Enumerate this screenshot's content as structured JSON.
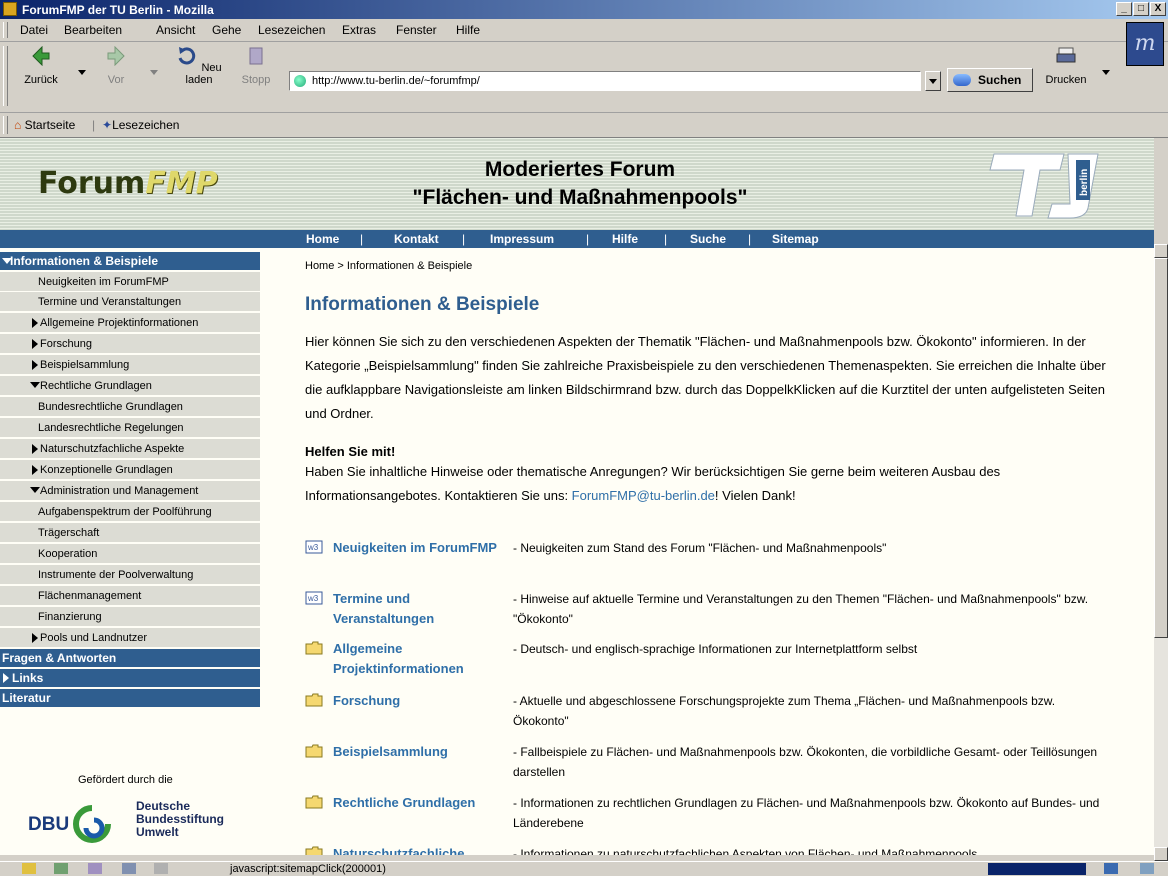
{
  "window": {
    "title": "ForumFMP der TU Berlin - Mozilla",
    "controls": [
      "_",
      "□",
      "X"
    ]
  },
  "menu": [
    "Datei",
    "Bearbeiten",
    "Ansicht",
    "Gehe",
    "Lesezeichen",
    "Extras",
    "Fenster",
    "Hilfe"
  ],
  "toolbar": {
    "back": "Zurück",
    "forward": "Vor",
    "reload": "Neu laden",
    "stop": "Stopp",
    "search": "Suchen",
    "print": "Drucken"
  },
  "url": "http://www.tu-berlin.de/~forumfmp/",
  "bookmarks": {
    "home": "Startseite",
    "bookmarks": "Lesezeichen"
  },
  "banner": {
    "logo_forum": "Forum",
    "logo_fmp": "FMP",
    "title_line1": "Moderiertes Forum",
    "title_line2": "\"Flächen- und Maßnahmenpools\"",
    "tu_text": "berlin"
  },
  "topnav": [
    "Home",
    "Kontakt",
    "Impressum",
    "Hilfe",
    "Suche",
    "Sitemap"
  ],
  "topnav_sep": "|",
  "sidebar": {
    "info": "Informationen & Beispiele",
    "items": [
      "Neuigkeiten im ForumFMP",
      "Termine und Veranstaltungen",
      "Allgemeine Projektinformationen",
      "Forschung",
      "Beispielsammlung",
      "Rechtliche Grundlagen",
      "Bundesrechtliche Grundlagen",
      "Landesrechtliche Regelungen",
      "Naturschutzfachliche Aspekte",
      "Konzeptionelle Grundlagen",
      "Administration und Management",
      "Aufgabenspektrum der Poolführung",
      "Trägerschaft",
      "Kooperation",
      "Instrumente der Poolverwaltung",
      "Flächenmanagement",
      "Finanzierung",
      "Pools und Landnutzer"
    ],
    "faq": "Fragen & Antworten",
    "links": "Links",
    "literatur": "Literatur",
    "sponsor": "Gefördert durch die",
    "dbu_abbr": "DBU",
    "dbu_name1": "Deutsche",
    "dbu_name2": "Bundesstiftung",
    "dbu_name3": "Umwelt"
  },
  "content": {
    "breadcrumb": "Home  >  Informationen & Beispiele",
    "heading": "Informationen & Beispiele",
    "intro": "Hier können Sie sich zu den verschiedenen Aspekten der Thematik \"Flächen- und Maßnahmenpools bzw. Ökokonto\" informieren. In der Kategorie „Beispielsammlung\" finden Sie zahlreiche Praxisbeispiele zu den verschiedenen Themenaspekten. Sie erreichen die Inhalte über die aufklappbare Navigationsleiste am linken Bildschirmrand bzw. durch das DoppelkKlicken auf die Kurztitel der unten aufgelisteten Seiten und Ordner.",
    "help_heading": "Helfen Sie mit!",
    "help_text": "Haben Sie inhaltliche Hinweise oder thematische Anregungen? Wir berücksichtigen Sie gerne beim weiteren Ausbau des Informationsangebotes. Kontaktieren Sie uns: ",
    "help_email": "ForumFMP@tu-berlin.de",
    "help_end": "! Vielen Dank!",
    "entries": [
      {
        "title": "Neuigkeiten im ForumFMP",
        "desc": "-  Neuigkeiten zum Stand des Forum \"Flächen- und Maßnahmenpools\"",
        "icon": "page-icon"
      },
      {
        "title": "Termine und Veranstaltungen",
        "desc": "-  Hinweise auf aktuelle Termine und Veranstaltungen zu den Themen \"Flächen- und Maßnahmenpools\" bzw. \"Ökokonto\"",
        "icon": "page-icon"
      },
      {
        "title": "Allgemeine Projektinformationen",
        "desc": "-  Deutsch- und englisch-sprachige Informationen zur Internetplattform selbst",
        "icon": "folder-icon"
      },
      {
        "title": "Forschung",
        "desc": "-  Aktuelle und abgeschlossene Forschungsprojekte zum Thema „Flächen- und Maßnahmenpools bzw. Ökokonto\"",
        "icon": "folder-icon"
      },
      {
        "title": "Beispielsammlung",
        "desc": "-  Fallbeispiele zu Flächen- und Maßnahmenpools bzw. Ökokonten, die vorbildliche Gesamt- oder Teillösungen darstellen",
        "icon": "folder-icon"
      },
      {
        "title": "Rechtliche Grundlagen",
        "desc": "-  Informationen zu rechtlichen Grundlagen zu Flächen- und Maßnahmenpools bzw. Ökokonto auf Bundes- und Länderebene",
        "icon": "folder-icon"
      },
      {
        "title": "Naturschutzfachliche",
        "desc": "-  Informationen zu naturschutzfachlichen Aspekten von Flächen- und Maßnahmenpools",
        "icon": "folder-icon"
      }
    ]
  },
  "status": "javascript:sitemapClick(200001)"
}
